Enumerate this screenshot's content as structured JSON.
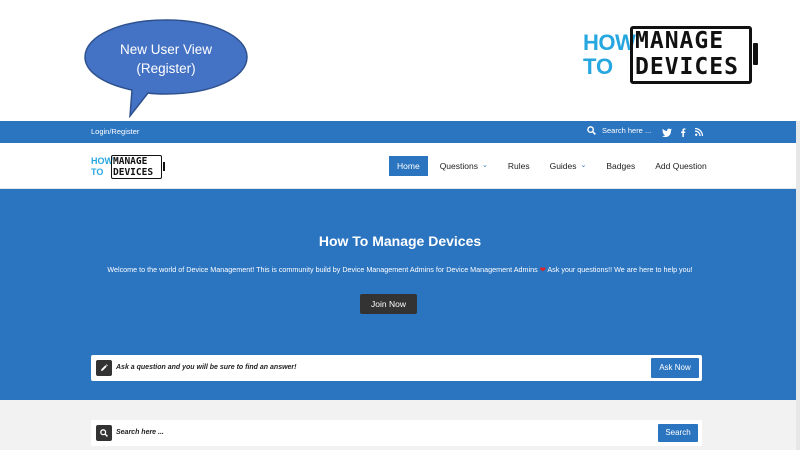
{
  "callout": {
    "line1": "New User View",
    "line2": "(Register)",
    "fill": "#4472c4"
  },
  "logo": {
    "how": "HOW",
    "to": "TO",
    "manage": "MANAGE",
    "devices": "DEVICES",
    "accent": "#27a7e0"
  },
  "topbar": {
    "login_label": "Login/Register",
    "search_placeholder": "Search here ...",
    "social": [
      "twitter-icon",
      "facebook-icon",
      "rss-icon"
    ]
  },
  "nav": {
    "items": [
      {
        "label": "Home",
        "active": true
      },
      {
        "label": "Questions",
        "dropdown": true
      },
      {
        "label": "Rules"
      },
      {
        "label": "Guides",
        "dropdown": true
      },
      {
        "label": "Badges"
      },
      {
        "label": "Add Question"
      }
    ]
  },
  "hero": {
    "title": "How To Manage Devices",
    "welcome_before": "Welcome to the world of Device Management! This is community build by Device Management Admins for Device Management Admins",
    "welcome_after": " Ask your questions!! We are here to help you!",
    "join_label": "Join Now"
  },
  "ask": {
    "placeholder": "Ask a question and you will be sure to find an answer!",
    "button": "Ask Now"
  },
  "search": {
    "placeholder": "Search here ...",
    "button": "Search"
  },
  "colors": {
    "brand_blue": "#2b74c0",
    "dark": "#333333",
    "light_bg": "#f2f2f2"
  }
}
